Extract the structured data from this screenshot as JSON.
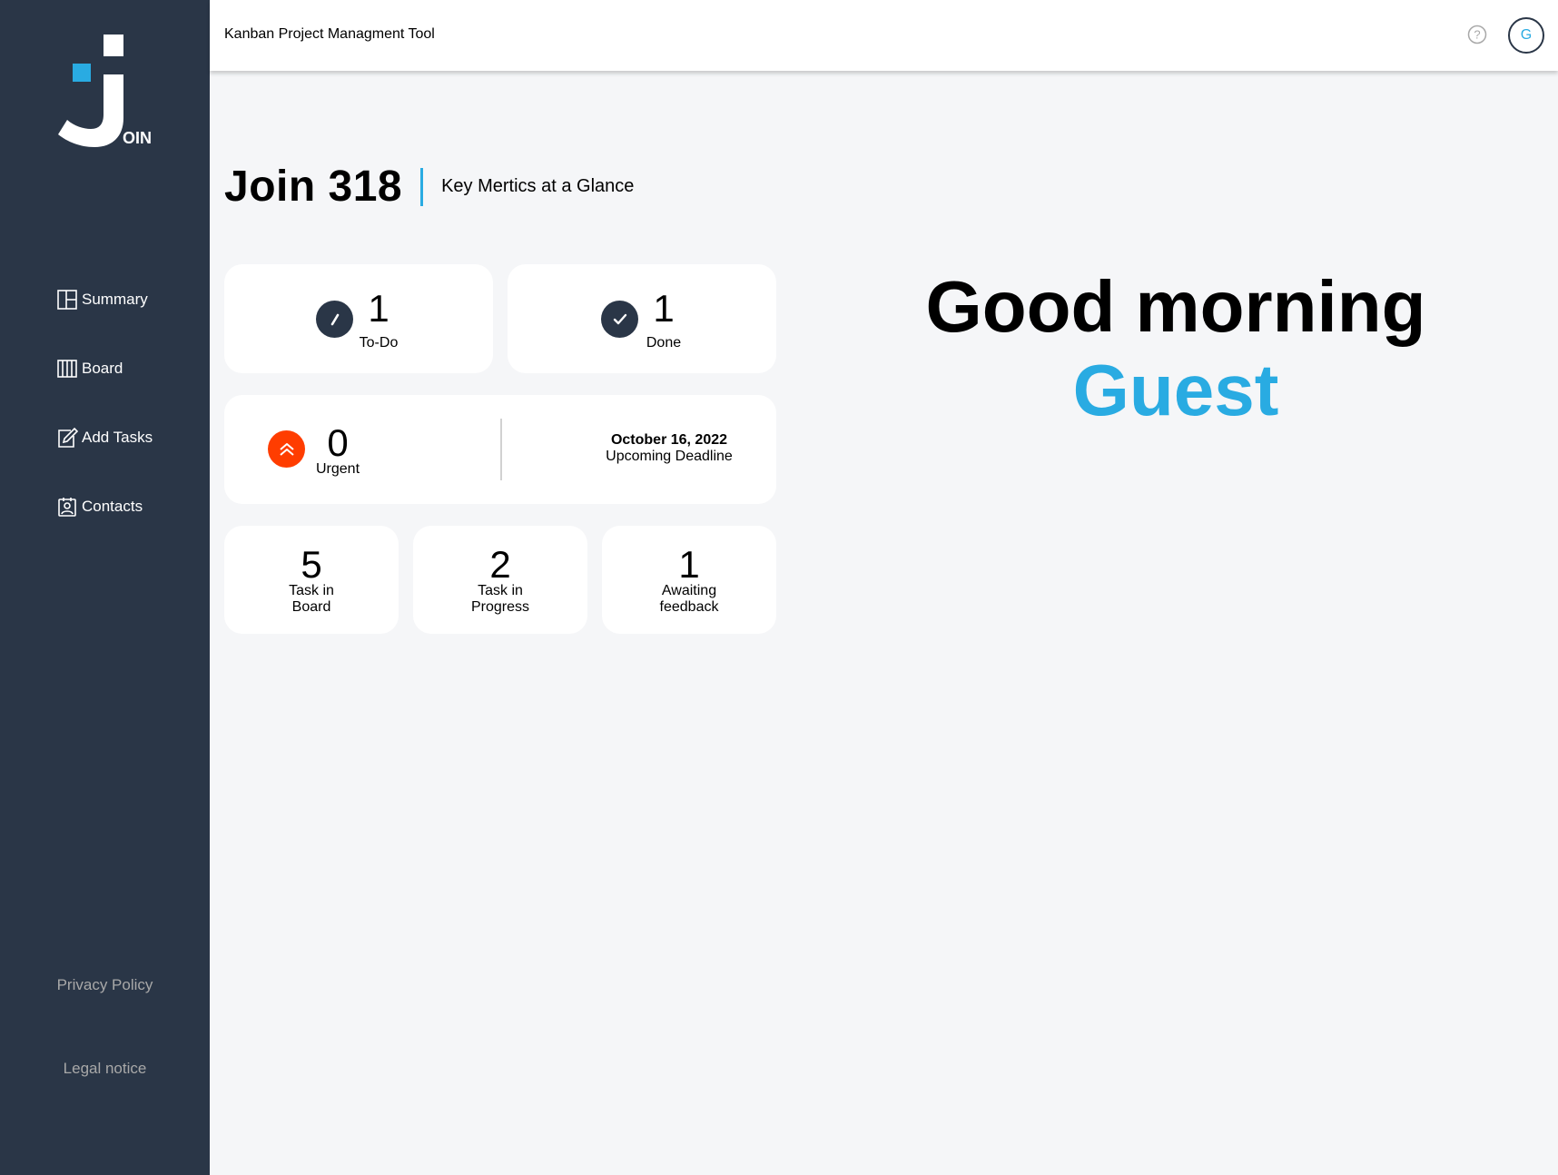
{
  "app": {
    "title": "Kanban Project Managment Tool",
    "logo_text": "OIN"
  },
  "colors": {
    "sidebar": "#2a3647",
    "accent": "#29abe2",
    "urgent": "#ff3d00",
    "background": "#f5f6f8"
  },
  "sidebar": {
    "items": [
      {
        "label": "Summary",
        "icon": "summary-icon"
      },
      {
        "label": "Board",
        "icon": "board-icon"
      },
      {
        "label": "Add Tasks",
        "icon": "add-task-icon"
      },
      {
        "label": "Contacts",
        "icon": "contacts-icon"
      }
    ],
    "privacy_policy": "Privacy Policy",
    "legal_notice": "Legal notice"
  },
  "header": {
    "help_icon": "help-icon",
    "avatar_initial": "G"
  },
  "summary": {
    "title": "Join 318",
    "subtitle": "Key Mertics at a Glance",
    "todo": {
      "count": "1",
      "label": "To-Do"
    },
    "done": {
      "count": "1",
      "label": "Done"
    },
    "urgent": {
      "count": "0",
      "label": "Urgent"
    },
    "deadline": {
      "date": "October 16, 2022",
      "label": "Upcoming Deadline"
    },
    "stats": [
      {
        "count": "5",
        "line1": "Task in",
        "line2": "Board"
      },
      {
        "count": "2",
        "line1": "Task in",
        "line2": "Progress"
      },
      {
        "count": "1",
        "line1": "Awaiting",
        "line2": "feedback"
      }
    ]
  },
  "greeting": {
    "text": "Good morning",
    "name": "Guest"
  }
}
